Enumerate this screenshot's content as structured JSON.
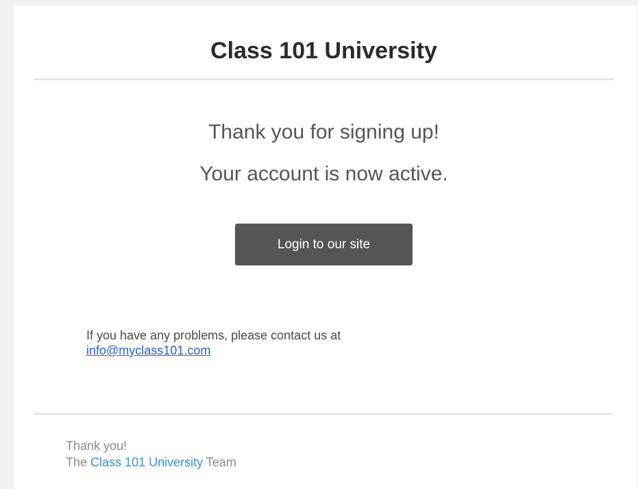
{
  "header": {
    "title": "Class 101 University"
  },
  "message": {
    "line1": "Thank you for signing up!",
    "line2": "Your account is now active."
  },
  "cta": {
    "label": "Login to our site"
  },
  "contact": {
    "text": "If you have any problems, please contact us at",
    "email": "info@myclass101.com"
  },
  "footer": {
    "thanks": "Thank you!",
    "team_prefix": "The",
    "team_brand": "Class 101 University",
    "team_suffix": "Team"
  },
  "colors": {
    "button_bg": "#555555",
    "link": "#2563c9",
    "footer_brand": "#3d8fd0",
    "divider": "#e6e6e6"
  }
}
